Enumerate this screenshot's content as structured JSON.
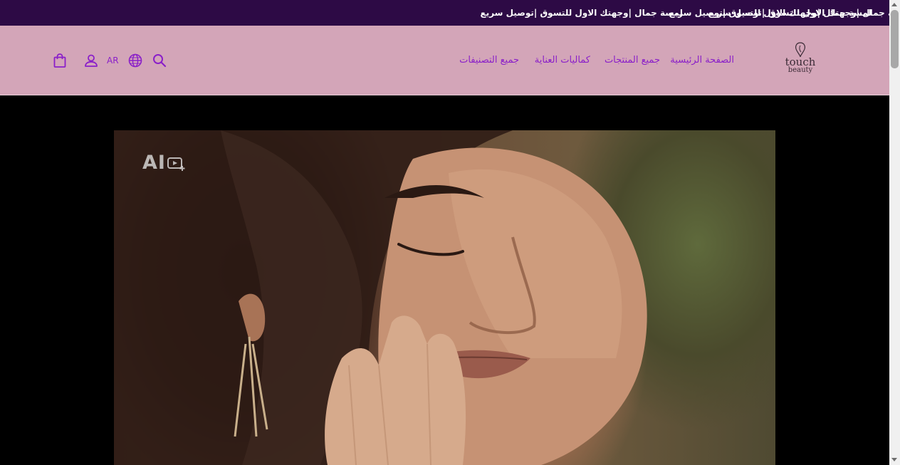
{
  "announcement": {
    "messages": [
      "لمسة جمال |وجهتك الاول للتسوق |توصيل سريع",
      "لمسة جمال |وجهتك الاول للتسوق |توصيل سريع",
      "لمسة جمال |وجهتك الاول للتسوق |توصيل سريع"
    ]
  },
  "header": {
    "logo": {
      "line1": "touch",
      "line2": "beauty"
    },
    "nav": [
      {
        "label": "الصفحة الرئيسية"
      },
      {
        "label": "جميع المنتجات"
      },
      {
        "label": "كماليات العناية"
      },
      {
        "label": "جميع التصنيفات"
      }
    ],
    "language_label": "AR",
    "icons": [
      "search-icon",
      "globe-icon",
      "user-icon",
      "shopping-bag-icon"
    ]
  },
  "hero": {
    "badge_text": "AI"
  },
  "colors": {
    "announcement_bg": "#2d0a45",
    "header_bg": "#d3a5b8",
    "accent": "#8a1fc9",
    "hero_bg": "#000000"
  }
}
